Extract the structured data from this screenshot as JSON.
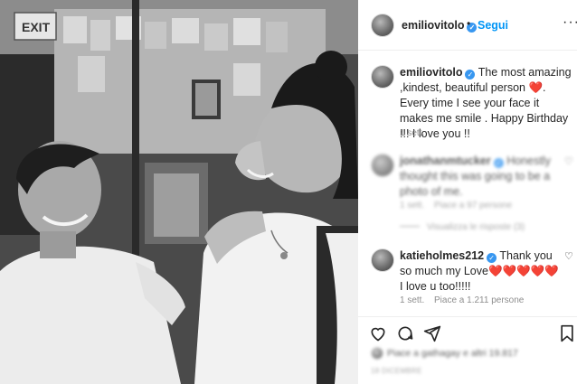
{
  "post": {
    "username": "emiliovitolo",
    "follow_label": "Segui",
    "separator": "•",
    "caption_text": "The most amazing ,kindest, beautiful person",
    "caption_heart": "❤️",
    "caption_text2": ". Every time I see your face it makes me smile . Happy Birthday !!! I love you !!",
    "caption_time": "1 sett."
  },
  "comments": [
    {
      "username": "jonathanmtucker",
      "text": "Honestly thought this was going to be a photo of me.",
      "time": "1 sett.",
      "likes": "Piace a 97 persone",
      "replies": "Visualizza le risposte (3)"
    },
    {
      "username": "katieholmes212",
      "text_before": "Thank you so much my Love",
      "hearts": "❤️❤️❤️❤️❤️",
      "text_after": " I love u too!!!!!",
      "time": "1 sett.",
      "likes": "Piace a 1.211 persone"
    }
  ],
  "footer": {
    "liked_by": "Piace a gathagay e altri 19.817",
    "date": "18 DICEMBRE"
  },
  "photo": {
    "sign_text": "EXIT"
  },
  "icons": [
    "verified-badge-icon",
    "more-icon",
    "heart-icon",
    "comment-icon",
    "share-icon",
    "bookmark-icon"
  ]
}
